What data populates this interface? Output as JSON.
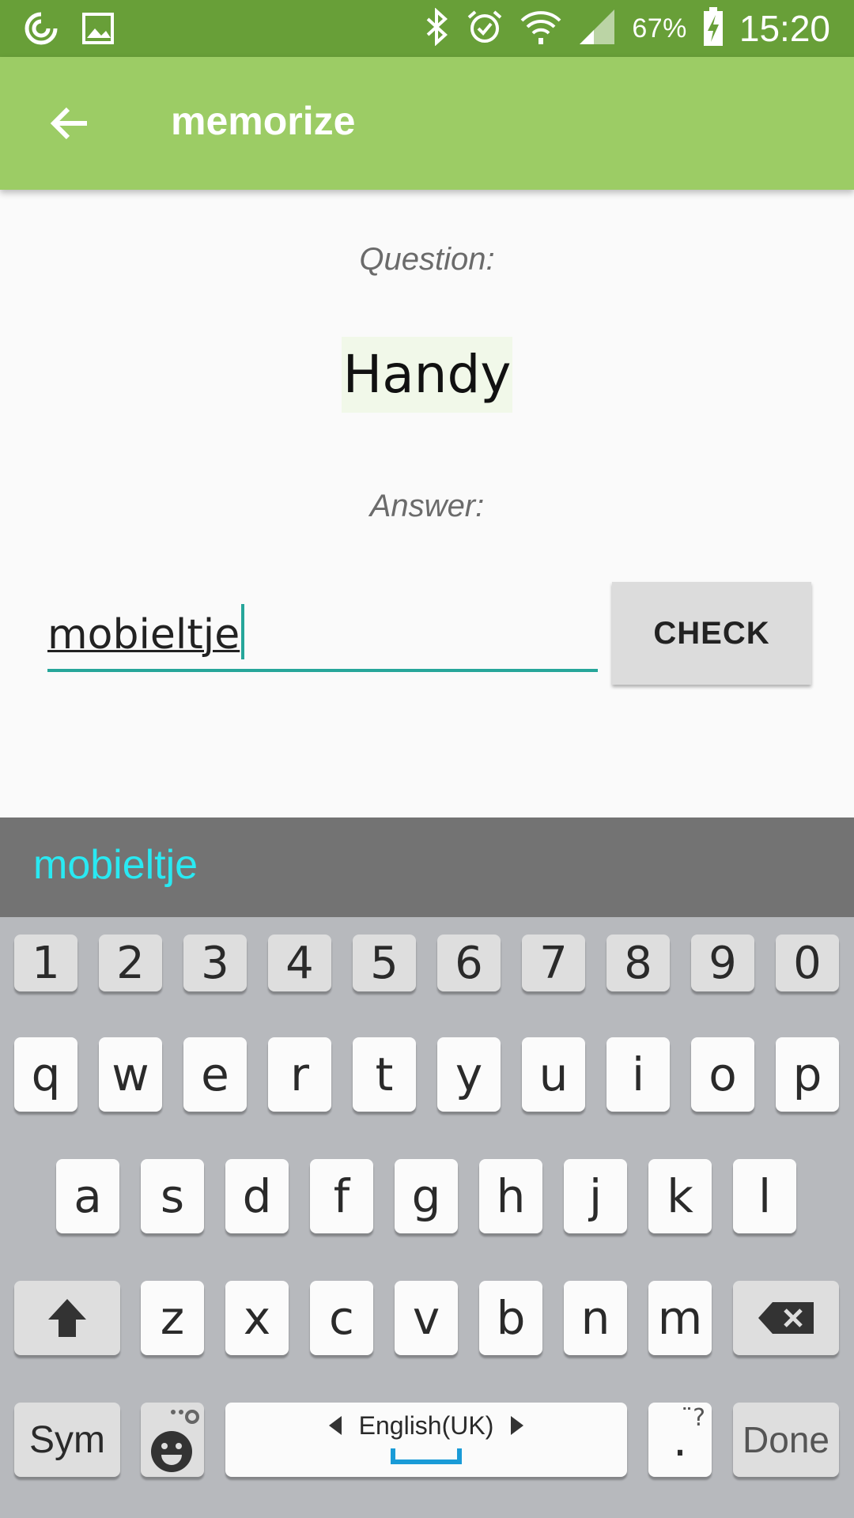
{
  "status_bar": {
    "battery": "67%",
    "time": "15:20",
    "icons": [
      "sync-icon",
      "gallery-icon",
      "bluetooth-icon",
      "alarm-icon",
      "wifi-icon",
      "signal-icon",
      "battery-charging-icon"
    ]
  },
  "toolbar": {
    "title": "memorize",
    "back_icon": "arrow-back-icon"
  },
  "quiz": {
    "question_label": "Question:",
    "question": "Handy",
    "answer_label": "Answer:",
    "answer_value": "mobieltje",
    "check_label": "CHECK"
  },
  "keyboard": {
    "suggestion": "mobieltje",
    "numbers": [
      "1",
      "2",
      "3",
      "4",
      "5",
      "6",
      "7",
      "8",
      "9",
      "0"
    ],
    "row1": [
      "q",
      "w",
      "e",
      "r",
      "t",
      "y",
      "u",
      "i",
      "o",
      "p"
    ],
    "row2": [
      "a",
      "s",
      "d",
      "f",
      "g",
      "h",
      "j",
      "k",
      "l"
    ],
    "row3": [
      "z",
      "x",
      "c",
      "v",
      "b",
      "n",
      "m"
    ],
    "sym_label": "Sym",
    "language": "English(UK)",
    "period": ".",
    "done_label": "Done"
  },
  "colors": {
    "status_bar": "#689f38",
    "toolbar": "#9ccc65",
    "accent": "#26a69a",
    "suggestion_text": "#29e9f2"
  }
}
